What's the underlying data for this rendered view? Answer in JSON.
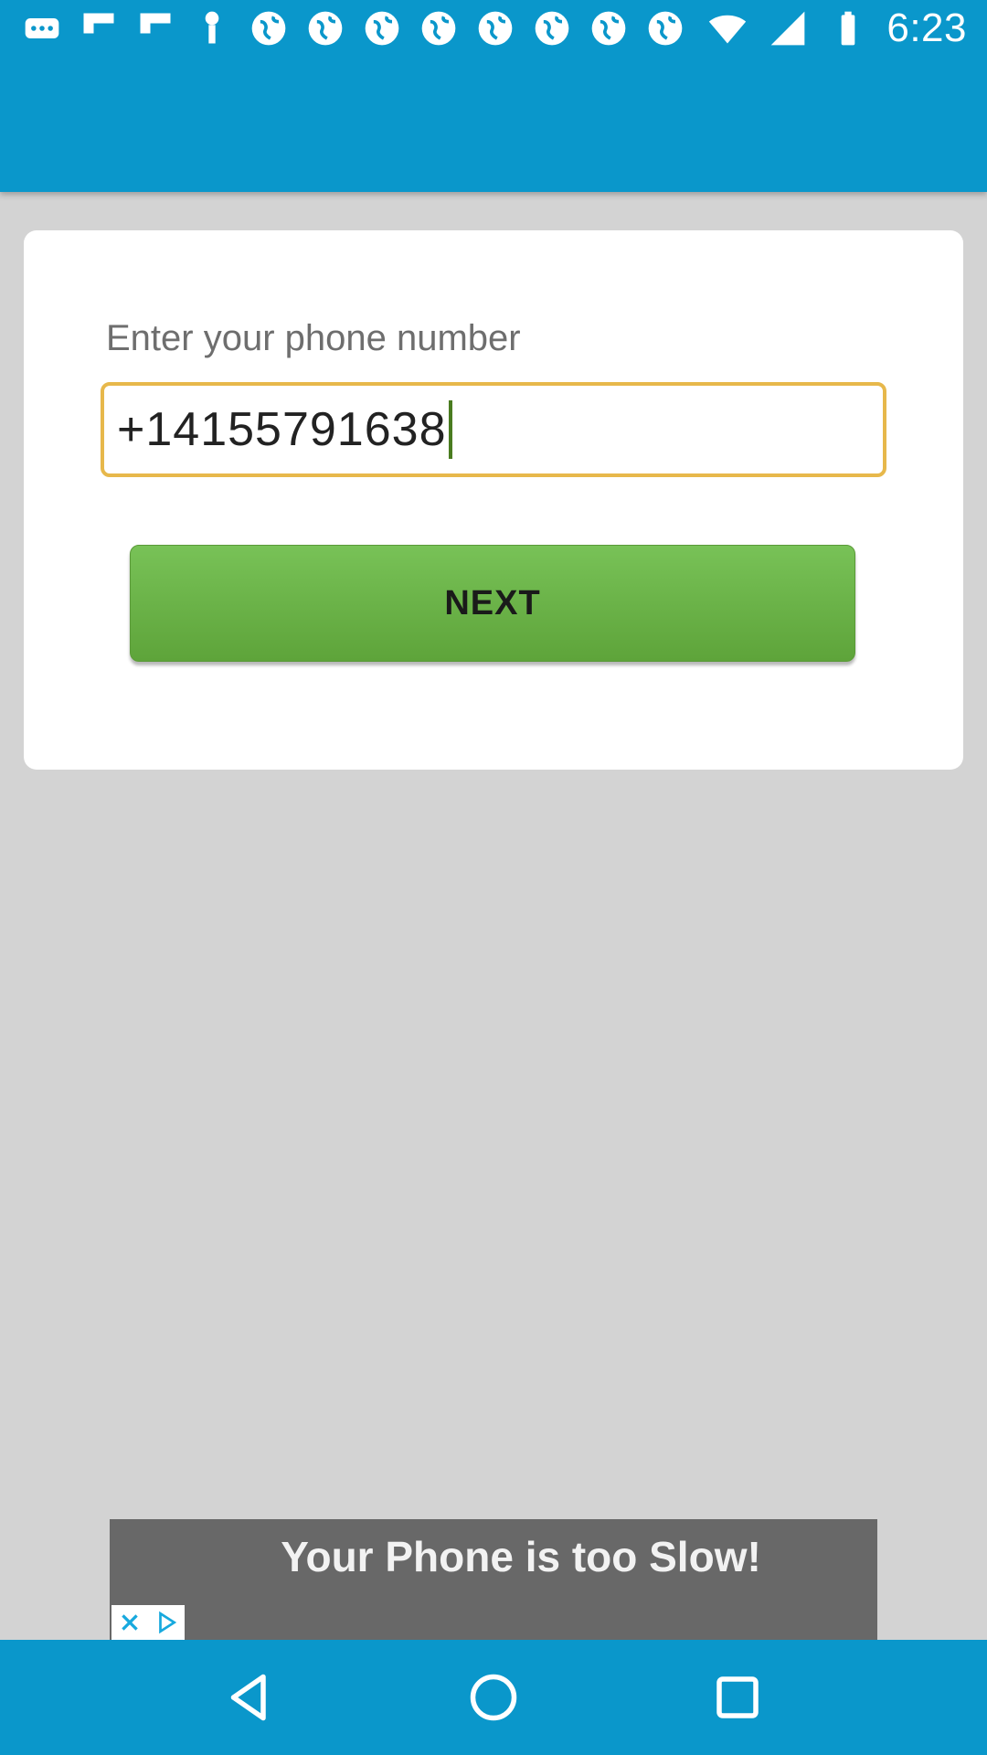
{
  "status_bar": {
    "time": "6:23",
    "left_icons": [
      "more-notifications-icon",
      "flipboard-icon",
      "flipboard-icon",
      "download-icon",
      "globe-icon",
      "globe-icon",
      "globe-icon",
      "globe-icon",
      "globe-icon",
      "globe-icon",
      "globe-icon",
      "globe-icon"
    ],
    "right_icons": [
      "wifi-icon",
      "signal-icon",
      "battery-icon"
    ]
  },
  "form": {
    "prompt": "Enter your phone number",
    "phone_value": "+14155791638",
    "next_label": "NEXT"
  },
  "ad": {
    "text": "Your Phone is too Slow!"
  },
  "nav": {
    "buttons": [
      "back-icon",
      "home-icon",
      "recents-icon"
    ]
  },
  "colors": {
    "primary": "#0a97cb",
    "button_green": "#6ab348",
    "field_border": "#e7b84b",
    "background": "#d3d3d3"
  }
}
